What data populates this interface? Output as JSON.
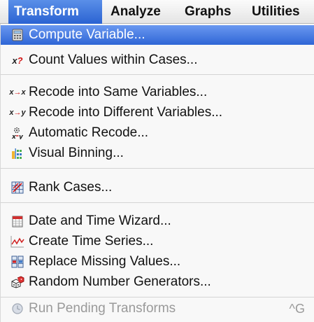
{
  "menubar": {
    "items": [
      {
        "label": "Transform"
      },
      {
        "label": "Analyze"
      },
      {
        "label": "Graphs"
      },
      {
        "label": "Utilities"
      }
    ]
  },
  "menu": {
    "items": [
      {
        "label": "Compute Variable..."
      },
      {
        "label": "Count Values within Cases...",
        "icon_text": "x?"
      },
      {
        "label": "Recode into Same Variables...",
        "icon_text": "x→x"
      },
      {
        "label": "Recode into Different Variables...",
        "icon_text": "x→y"
      },
      {
        "label": "Automatic Recode..."
      },
      {
        "label": "Visual Binning..."
      },
      {
        "label": "Rank Cases..."
      },
      {
        "label": "Date and Time Wizard..."
      },
      {
        "label": "Create Time Series..."
      },
      {
        "label": "Replace Missing Values..."
      },
      {
        "label": "Random Number Generators..."
      },
      {
        "label": "Run Pending Transforms",
        "shortcut": "^G"
      }
    ]
  }
}
